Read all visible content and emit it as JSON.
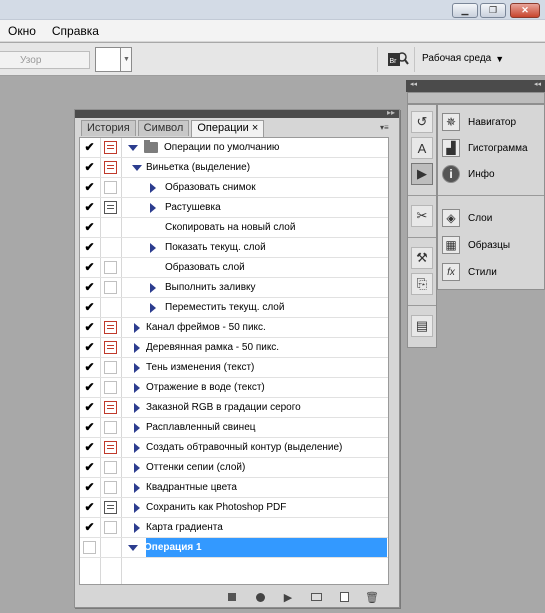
{
  "menubar": {
    "items": [
      "Окно",
      "Справка"
    ]
  },
  "options": {
    "pattern_placeholder": "Узор",
    "workspace_label": "Рабочая среда",
    "bridge_icon": "Br"
  },
  "panel": {
    "tabs": [
      "История",
      "Символ",
      "Операции"
    ],
    "tab_close": "×",
    "menu_glyph": "▸▸"
  },
  "actions": [
    {
      "label": "Операции по умолчанию",
      "check": true,
      "dialog": "red",
      "kind": "set"
    },
    {
      "label": "Виньетка (выделение)",
      "check": true,
      "dialog": "red",
      "kind": "action-open"
    },
    {
      "label": "Образовать снимок",
      "check": true,
      "dialog": "empty",
      "kind": "step-closed"
    },
    {
      "label": "Растушевка",
      "check": true,
      "dialog": "dlg",
      "kind": "step-closed"
    },
    {
      "label": "Скопировать на новый слой",
      "check": true,
      "dialog": "none",
      "kind": "step"
    },
    {
      "label": "Показать текущ. слой",
      "check": true,
      "dialog": "none",
      "kind": "step-closed"
    },
    {
      "label": "Образовать слой",
      "check": true,
      "dialog": "empty",
      "kind": "step"
    },
    {
      "label": "Выполнить заливку",
      "check": true,
      "dialog": "empty",
      "kind": "step-closed"
    },
    {
      "label": "Переместить текущ. слой",
      "check": true,
      "dialog": "none",
      "kind": "step-closed"
    },
    {
      "label": "Канал фреймов - 50 пикс.",
      "check": true,
      "dialog": "red",
      "kind": "action"
    },
    {
      "label": "Деревянная рамка - 50 пикс.",
      "check": true,
      "dialog": "red",
      "kind": "action"
    },
    {
      "label": "Тень изменения (текст)",
      "check": true,
      "dialog": "empty",
      "kind": "action"
    },
    {
      "label": "Отражение в воде (текст)",
      "check": true,
      "dialog": "empty",
      "kind": "action"
    },
    {
      "label": "Заказной RGB в градации серого",
      "check": true,
      "dialog": "red",
      "kind": "action"
    },
    {
      "label": "Расплавленный свинец",
      "check": true,
      "dialog": "empty",
      "kind": "action"
    },
    {
      "label": "Создать обтравочный контур (выделение)",
      "check": true,
      "dialog": "red",
      "kind": "action"
    },
    {
      "label": "Оттенки сепии (слой)",
      "check": true,
      "dialog": "empty",
      "kind": "action"
    },
    {
      "label": "Квадрантные цвета",
      "check": true,
      "dialog": "empty",
      "kind": "action"
    },
    {
      "label": "Сохранить как Photoshop PDF",
      "check": true,
      "dialog": "dlg",
      "kind": "action"
    },
    {
      "label": "Карта градиента",
      "check": true,
      "dialog": "empty",
      "kind": "action"
    },
    {
      "label": "Операция 1",
      "check": false,
      "dialog": "none",
      "kind": "set-selected"
    }
  ],
  "footer_icons": [
    "stop-icon",
    "record-icon",
    "play-icon",
    "new-set-icon",
    "new-action-icon",
    "trash-icon"
  ],
  "dock": {
    "group1": [
      "Навигатор",
      "Гистограмма",
      "Инфо"
    ],
    "group2": [
      "Слои",
      "Образцы",
      "Стили"
    ]
  }
}
